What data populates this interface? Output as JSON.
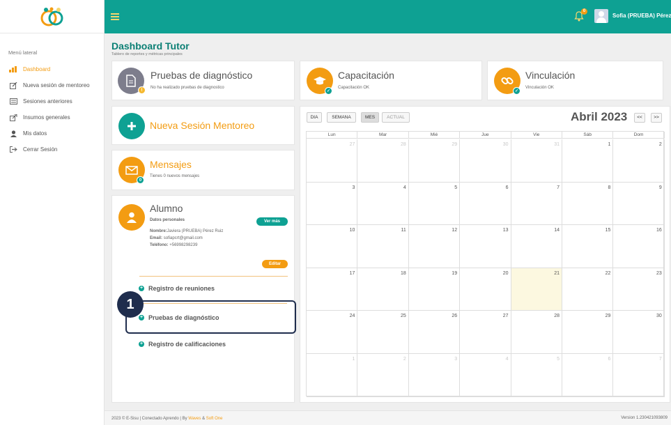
{
  "sidebar": {
    "title": "Menú lateral",
    "items": [
      {
        "label": "Dashboard",
        "icon": "chart-icon"
      },
      {
        "label": "Nueva sesión de mentoreo",
        "icon": "edit-icon"
      },
      {
        "label": "Sesiones anteriores",
        "icon": "list-icon"
      },
      {
        "label": "Insumos generales",
        "icon": "external-link-icon"
      },
      {
        "label": "Mis datos",
        "icon": "user-icon"
      },
      {
        "label": "Cerrar Sesión",
        "icon": "sign-out-icon"
      }
    ]
  },
  "topbar": {
    "notifications": "0",
    "username": "Sofia (PRUEBA) Pérez ⌄"
  },
  "header": {
    "title": "Dashboard Tutor",
    "subtitle": "Tablero de reportes y métricas principales"
  },
  "cards": {
    "diagnostico": {
      "title": "Pruebas de diagnóstico",
      "text": "No ha realizado pruebas de diagnostico"
    },
    "capacitacion": {
      "title": "Capacitación",
      "text": "Capacitación OK"
    },
    "vinculacion": {
      "title": "Vinculación",
      "text": "Vinculación OK"
    },
    "nueva_sesion": {
      "title": "Nueva Sesión Mentoreo"
    },
    "mensajes": {
      "title": "Mensajes",
      "text": "Tienes 0 nuevos mensajes",
      "count": "0"
    },
    "alumno": {
      "title": "Alumno",
      "section": "Datos personales",
      "ver_mas": "Ver más",
      "nombre_label": "Nombre:",
      "nombre": "Javiera (PRUEBA) Pérez Ruiz",
      "email_label": "Email:",
      "email": "sofiapcrt@gmail.com",
      "telefono_label": "Teléfono:",
      "telefono": "+56998298239",
      "editar": "Editar",
      "links": [
        "Registro de reuniones",
        "Pruebas de diagnóstico",
        "Registro de calificaciones"
      ]
    }
  },
  "annotation": {
    "step": "1"
  },
  "calendar": {
    "views": [
      "DIA",
      "SEMANA",
      "MES",
      "ACTUAL"
    ],
    "active_view": "MES",
    "month": "Abril 2023",
    "prev": "<<",
    "next": ">>",
    "days": [
      "Lun",
      "Mar",
      "Mié",
      "Jue",
      "Vie",
      "Sáb",
      "Dom"
    ],
    "weeks": [
      [
        "27",
        "28",
        "29",
        "30",
        "31",
        "1",
        "2"
      ],
      [
        "3",
        "4",
        "5",
        "6",
        "7",
        "8",
        "9"
      ],
      [
        "10",
        "11",
        "12",
        "13",
        "14",
        "15",
        "16"
      ],
      [
        "17",
        "18",
        "19",
        "20",
        "21",
        "22",
        "23"
      ],
      [
        "24",
        "25",
        "26",
        "27",
        "28",
        "29",
        "30"
      ],
      [
        "1",
        "2",
        "3",
        "4",
        "5",
        "6",
        "7"
      ]
    ],
    "today": "21"
  },
  "footer": {
    "left_prefix": "2023 © E-Sisu | Conectado Aprendo | By ",
    "waves": "Waves",
    "amp": " & ",
    "softone": "Soft One",
    "version": "Version 1.230421093809"
  },
  "colors": {
    "primary": "#0ea193",
    "accent": "#f39c12",
    "dark": "#1f2d4d",
    "gray_icon": "#7d7d8c"
  }
}
